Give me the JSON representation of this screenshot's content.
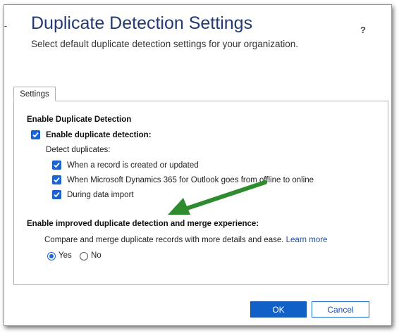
{
  "header": {
    "title": "Duplicate Detection Settings",
    "subtitle": "Select default duplicate detection settings for your organization.",
    "help": "?"
  },
  "tabs": [
    {
      "label": "Settings",
      "selected": true
    }
  ],
  "detection": {
    "section_title": "Enable Duplicate Detection",
    "enable_label": "Enable duplicate detection:",
    "enable_checked": true,
    "detect_label": "Detect duplicates:",
    "options": [
      {
        "label": "When a record is created or updated",
        "checked": true
      },
      {
        "label": "When Microsoft Dynamics 365 for Outlook goes from offline to online",
        "checked": true
      },
      {
        "label": "During data import",
        "checked": true
      }
    ]
  },
  "improved": {
    "section_title": "Enable improved duplicate detection and merge experience:",
    "description": "Compare and merge duplicate records with more details and ease.",
    "learn_more": "Learn more",
    "options": [
      {
        "label": "Yes",
        "selected": true
      },
      {
        "label": "No",
        "selected": false
      }
    ]
  },
  "annotation": {
    "arrow_color": "#2e8b2e",
    "arrow_icon": "green-arrow-icon"
  },
  "footer": {
    "ok_label": "OK",
    "cancel_label": "Cancel"
  },
  "colors": {
    "accent": "#1a64d6",
    "title": "#243a73"
  }
}
